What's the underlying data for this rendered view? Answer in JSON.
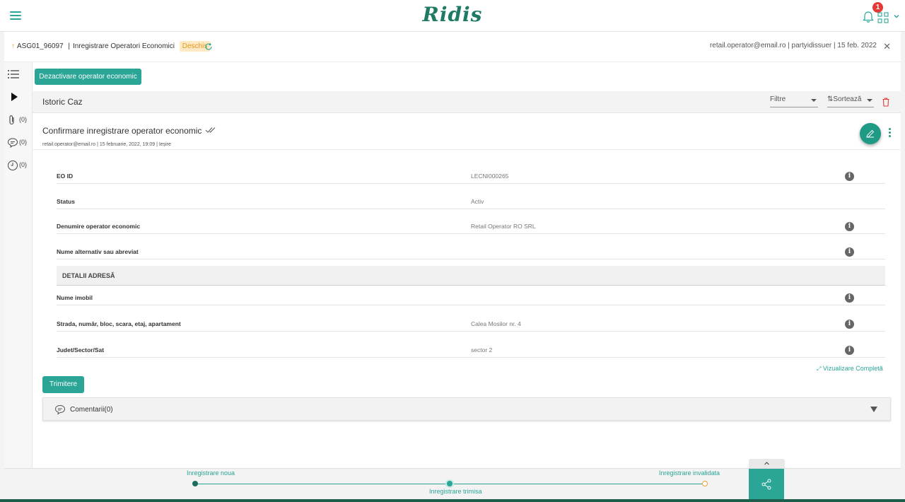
{
  "app": {
    "logo_text": "Ridis",
    "notification_count": "1",
    "accent_color": "#2aa596"
  },
  "case_header": {
    "case_id": "ASG01_96097",
    "separator": "|",
    "case_type": "Inregistrare Operatori Economici",
    "status": "Deschis",
    "meta": "retail.operator@email.ro | partyidissuer | 15 feb. 2022",
    "close_symbol": "✕"
  },
  "rail": {
    "attachments_count": "(0)",
    "comments_count": "(0)",
    "history_count": "(0)"
  },
  "actions": {
    "deactivate_label": "Dezactivare operator economic",
    "send_label": "Trimitere",
    "full_view_label": "Vizualizare Completă"
  },
  "history": {
    "title": "Istoric Caz",
    "filter_label": "Filtre",
    "sort_label": "Sortează"
  },
  "entry": {
    "title": "Confirmare inregistrare operator economic",
    "meta": "retail.operator@email.ro | 15 februarie, 2022, 19:09 | Ieșire"
  },
  "fields": [
    {
      "label": "EO ID",
      "value": "LECNI000265",
      "has_info": true
    },
    {
      "label": "Status",
      "value": "Activ",
      "has_info": false
    },
    {
      "label": "Denumire operator economic",
      "value": "Retail Operator RO SRL",
      "has_info": true
    },
    {
      "label": "Nume alternativ sau abreviat",
      "value": "",
      "has_info": true
    }
  ],
  "address_section": {
    "title": "DETALII ADRESĂ",
    "fields": [
      {
        "label": "Nume imobil",
        "value": "",
        "has_info": true
      },
      {
        "label": "Strada, număr, bloc, scara, etaj, apartament",
        "value": "Calea Mosilor nr. 4",
        "has_info": true
      },
      {
        "label": "Judet/Sector/Sat",
        "value": "sector 2",
        "has_info": true
      }
    ]
  },
  "comments": {
    "label": "Comentarii",
    "count": "(0)"
  },
  "stepper": {
    "steps": [
      {
        "label": "Inregistrare noua",
        "state": "done"
      },
      {
        "label": "Inregistrare trimisa",
        "state": "current"
      },
      {
        "label": "Inregistrare invalidata",
        "state": "pending"
      }
    ],
    "pending_color": "#f0a030"
  },
  "info_symbol": "i"
}
